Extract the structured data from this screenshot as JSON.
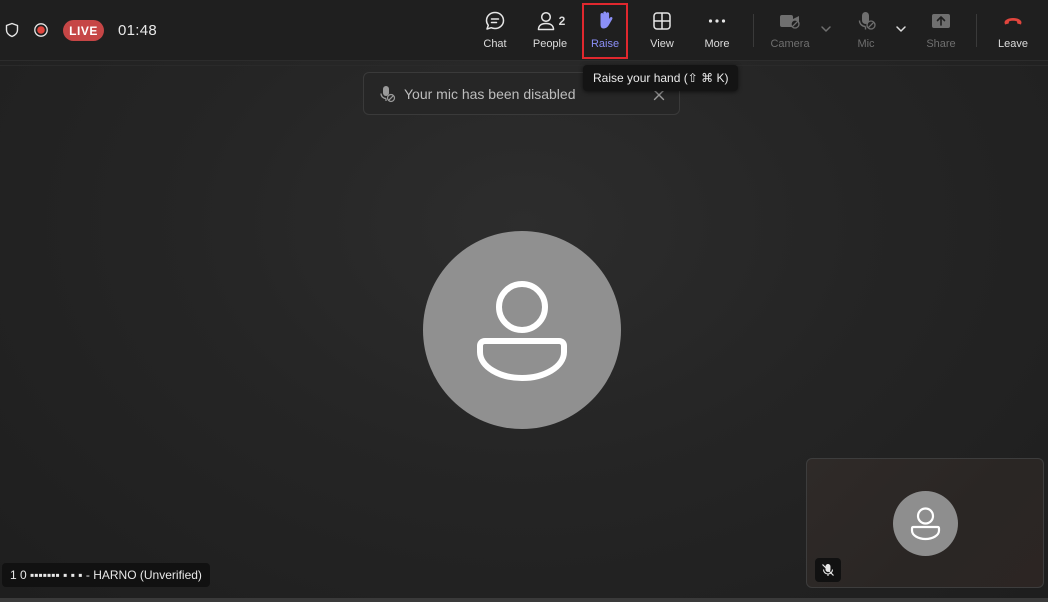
{
  "status": {
    "live_label": "LIVE",
    "timer": "01:48",
    "live_color": "#c64646"
  },
  "toolbar": {
    "chat": {
      "label": "Chat",
      "icon": "chat-icon"
    },
    "people": {
      "label": "People",
      "count": "2",
      "icon": "people-icon"
    },
    "raise": {
      "label": "Raise",
      "icon": "raised-hand-icon",
      "color": "#8b8ff7"
    },
    "view": {
      "label": "View",
      "icon": "grid-view-icon"
    },
    "more": {
      "label": "More",
      "icon": "ellipsis-icon"
    },
    "camera": {
      "label": "Camera",
      "icon": "camera-off-icon",
      "state": "disabled"
    },
    "mic": {
      "label": "Mic",
      "icon": "mic-off-icon",
      "state": "disabled"
    },
    "share": {
      "label": "Share",
      "icon": "share-screen-icon",
      "state": "disabled"
    },
    "leave": {
      "label": "Leave",
      "icon": "hang-up-icon",
      "color": "#e0453d"
    }
  },
  "tooltip": {
    "text": "Raise your hand (⇧ ⌘ K)"
  },
  "notice": {
    "text": "Your mic has been disabled"
  },
  "participant": {
    "name_label": "1 0 ▪▪▪▪▪▪▪ ▪ ▪ ▪ - HARNO (Unverified)"
  }
}
